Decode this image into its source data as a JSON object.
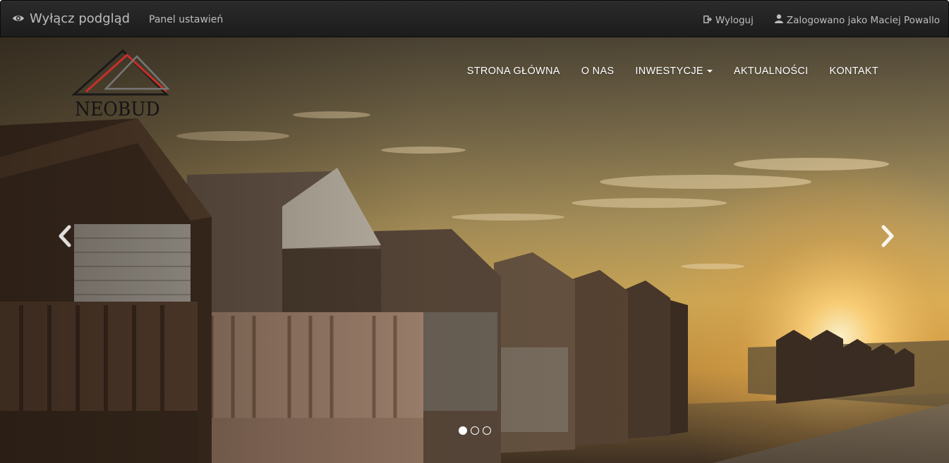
{
  "admin_bar": {
    "preview_label": "Wyłącz podgląd",
    "settings_label": "Panel ustawień",
    "logout_label": "Wyloguj",
    "logged_in_label": "Zalogowano jako Maciej Powallo",
    "icons": {
      "preview": "eye-icon",
      "logout": "logout-icon",
      "user": "user-icon"
    }
  },
  "logo": {
    "text": "NEOBUD",
    "colors": {
      "dark": "#1a1a1a",
      "red": "#c8302a",
      "gray": "#777777"
    }
  },
  "nav": {
    "items": [
      {
        "label": "STRONA GŁÓWNA",
        "has_dropdown": false
      },
      {
        "label": "O NAS",
        "has_dropdown": false
      },
      {
        "label": "INWESTYCJE",
        "has_dropdown": true
      },
      {
        "label": "AKTUALNOŚCI",
        "has_dropdown": false
      },
      {
        "label": "KONTAKT",
        "has_dropdown": false
      }
    ]
  },
  "carousel": {
    "slide_count": 3,
    "active_slide": 1,
    "prev_icon": "chevron-left-icon",
    "next_icon": "chevron-right-icon"
  }
}
